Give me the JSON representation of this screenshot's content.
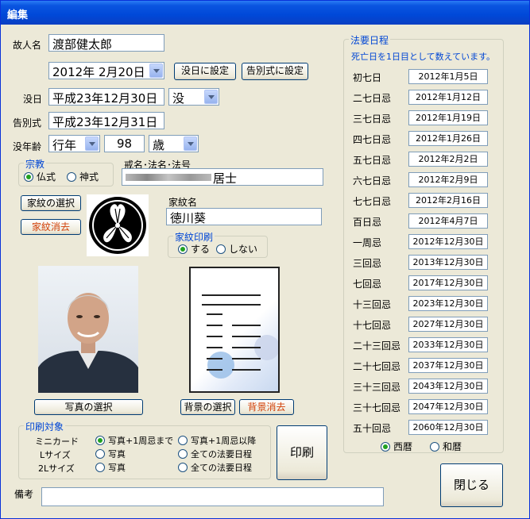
{
  "window": {
    "title": "編集"
  },
  "deceased": {
    "label": "故人名",
    "value": "渡部健太郎"
  },
  "date_picker": {
    "value": "2012年  2月20日"
  },
  "buttons": {
    "set_death": "没日に設定",
    "set_funeral": "告別式に設定",
    "select_crest": "家紋の選択",
    "delete_crest": "家紋消去",
    "select_photo": "写真の選択",
    "select_bg": "背景の選択",
    "delete_bg": "背景消去",
    "print": "印刷",
    "close": "閉じる"
  },
  "death": {
    "label": "没日",
    "value": "平成23年12月30日",
    "type": "没"
  },
  "funeral": {
    "label": "告別式",
    "value": "平成23年12月31日"
  },
  "age": {
    "label": "没年齢",
    "kind": "行年",
    "value": "98",
    "unit": "歳"
  },
  "religion": {
    "caption": "宗教",
    "options": [
      "仏式",
      "神式"
    ],
    "selected": 0
  },
  "kaimyo": {
    "label": "戒名･法名･法号",
    "suffix": "居士"
  },
  "crest": {
    "label": "家紋名",
    "value": "徳川葵"
  },
  "crest_print": {
    "caption": "家紋印刷",
    "options": [
      "する",
      "しない"
    ],
    "selected": 0
  },
  "print_target": {
    "caption": "印刷対象",
    "rows": [
      {
        "size": "ミニカード",
        "a": "写真+1周忌まで",
        "b": "写真+1周忌以降",
        "sel": "a"
      },
      {
        "size": "Lサイズ",
        "a": "写真",
        "b": "全ての法要日程",
        "sel": ""
      },
      {
        "size": "2Lサイズ",
        "a": "写真",
        "b": "全ての法要日程",
        "sel": ""
      }
    ]
  },
  "memo": {
    "label": "備考",
    "value": ""
  },
  "schedule": {
    "caption": "法要日程",
    "note": "死亡日を1日目として数えています。",
    "items": [
      {
        "name": "初七日",
        "date": "2012年1月5日"
      },
      {
        "name": "二七日忌",
        "date": "2012年1月12日"
      },
      {
        "name": "三七日忌",
        "date": "2012年1月19日"
      },
      {
        "name": "四七日忌",
        "date": "2012年1月26日"
      },
      {
        "name": "五七日忌",
        "date": "2012年2月2日"
      },
      {
        "name": "六七日忌",
        "date": "2012年2月9日"
      },
      {
        "name": "七七日忌",
        "date": "2012年2月16日"
      },
      {
        "name": "百日忌",
        "date": "2012年4月7日"
      },
      {
        "name": "一周忌",
        "date": "2012年12月30日"
      },
      {
        "name": "三回忌",
        "date": "2013年12月30日"
      },
      {
        "name": "七回忌",
        "date": "2017年12月30日"
      },
      {
        "name": "十三回忌",
        "date": "2023年12月30日"
      },
      {
        "name": "十七回忌",
        "date": "2027年12月30日"
      },
      {
        "name": "二十三回忌",
        "date": "2033年12月30日"
      },
      {
        "name": "二十七回忌",
        "date": "2037年12月30日"
      },
      {
        "name": "三十三回忌",
        "date": "2043年12月30日"
      },
      {
        "name": "三十七回忌",
        "date": "2047年12月30日"
      },
      {
        "name": "五十回忌",
        "date": "2060年12月30日"
      }
    ],
    "calendar_options": [
      "西暦",
      "和暦"
    ],
    "calendar_selected": 0
  }
}
